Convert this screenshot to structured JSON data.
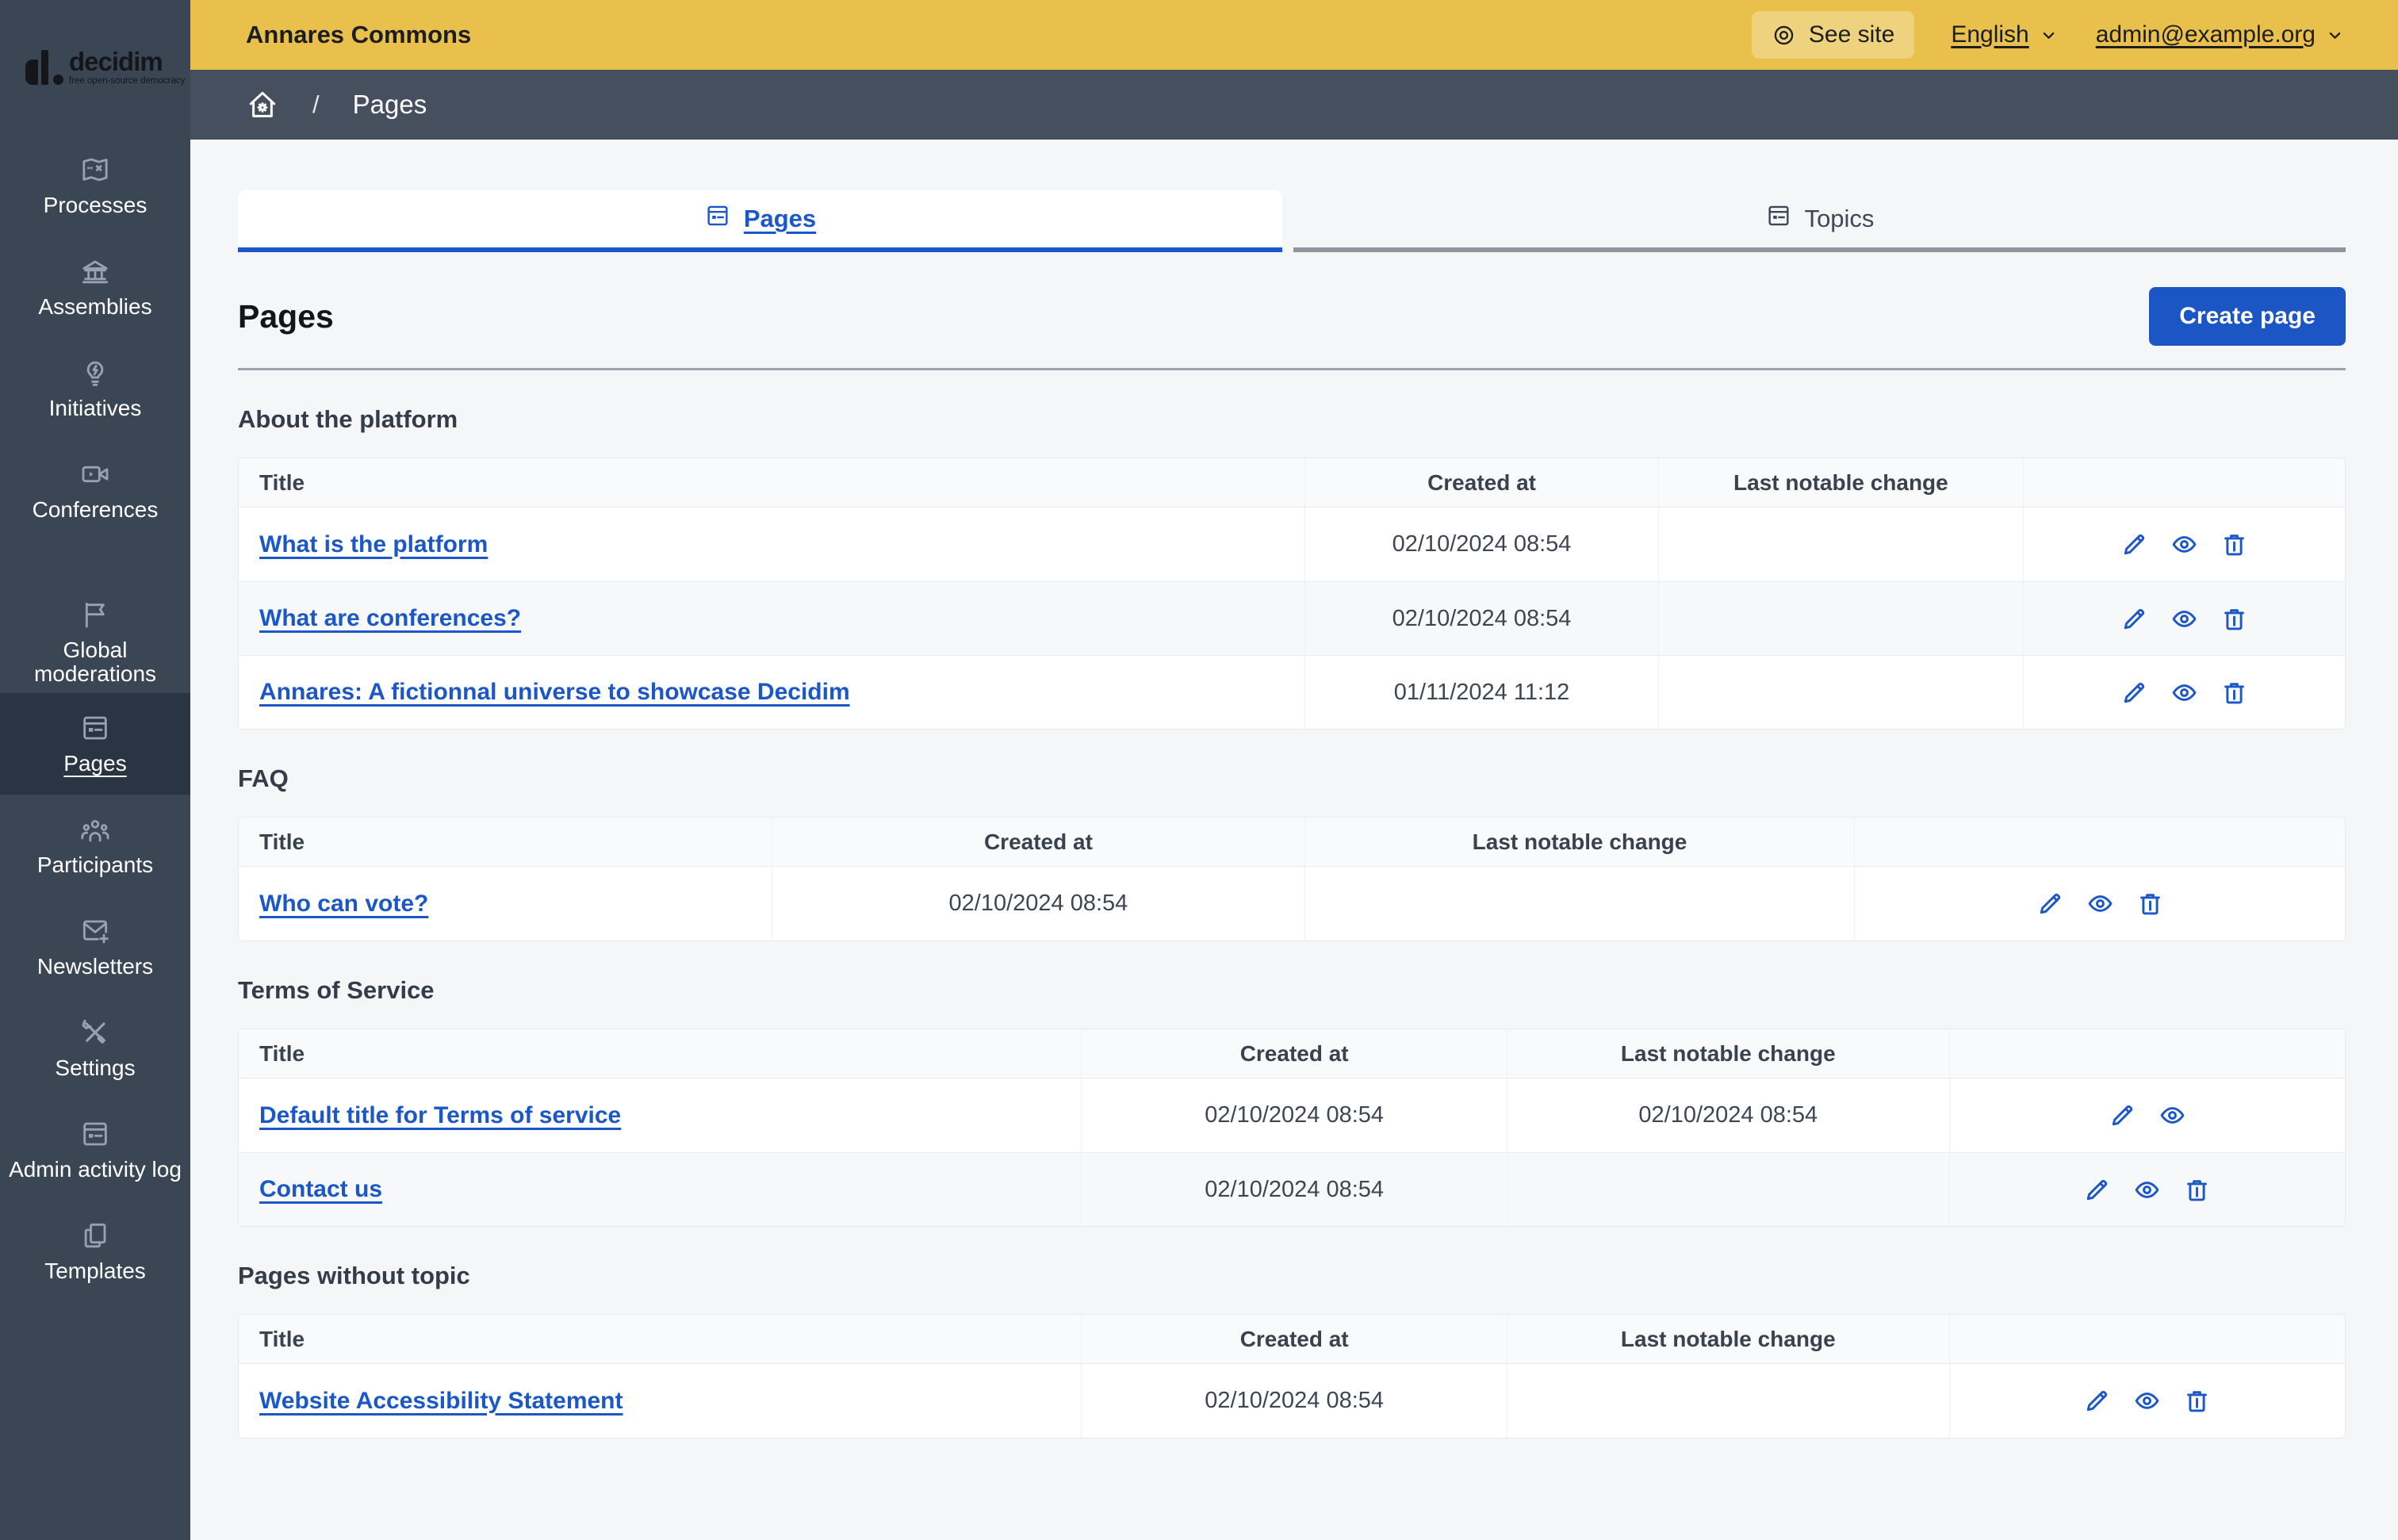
{
  "brand": {
    "logo_text": "decidim",
    "logo_tagline": "free open-source democracy"
  },
  "topbar": {
    "title": "Annares Commons",
    "see_site_label": "See site",
    "language_label": "English",
    "user_email": "admin@example.org"
  },
  "breadcrumb": {
    "separator": "/",
    "current": "Pages"
  },
  "sidebar": {
    "items": [
      {
        "label": "Processes",
        "icon": "map-icon",
        "active": false
      },
      {
        "label": "Assemblies",
        "icon": "bank-icon",
        "active": false
      },
      {
        "label": "Initiatives",
        "icon": "lightbulb-icon",
        "active": false
      },
      {
        "label": "Conferences",
        "icon": "video-camera-icon",
        "active": false
      },
      {
        "label": "Global moderations",
        "icon": "flag-icon",
        "active": false,
        "section_break": true
      },
      {
        "label": "Pages",
        "icon": "article-icon",
        "active": true
      },
      {
        "label": "Participants",
        "icon": "people-icon",
        "active": false
      },
      {
        "label": "Newsletters",
        "icon": "mail-add-icon",
        "active": false
      },
      {
        "label": "Settings",
        "icon": "tools-icon",
        "active": false
      },
      {
        "label": "Admin activity log",
        "icon": "article-icon",
        "active": false
      },
      {
        "label": "Templates",
        "icon": "copy-icon",
        "active": false
      }
    ]
  },
  "tabs": [
    {
      "label": "Pages",
      "icon": "article-icon",
      "active": true
    },
    {
      "label": "Topics",
      "icon": "article-icon",
      "active": false
    }
  ],
  "page": {
    "title": "Pages",
    "create_button_label": "Create page"
  },
  "sections": [
    {
      "title": "About the platform",
      "columns": [
        "Title",
        "Created at",
        "Last notable change"
      ],
      "col_widths": [
        "50.6%",
        "16.8%",
        "17.3%",
        "15.3%"
      ],
      "rows": [
        {
          "title": "What is the platform",
          "created_at": "02/10/2024 08:54",
          "last_change": "",
          "actions": [
            "edit",
            "preview",
            "delete"
          ]
        },
        {
          "title": "What are conferences?",
          "created_at": "02/10/2024 08:54",
          "last_change": "",
          "actions": [
            "edit",
            "preview",
            "delete"
          ]
        },
        {
          "title": "Annares: A fictionnal universe to showcase Decidim",
          "created_at": "01/11/2024 11:12",
          "last_change": "",
          "actions": [
            "edit",
            "preview",
            "delete"
          ]
        }
      ]
    },
    {
      "title": "FAQ",
      "columns": [
        "Title",
        "Created at",
        "Last notable change"
      ],
      "col_widths": [
        "25.3%",
        "25.3%",
        "26.1%",
        "23.3%"
      ],
      "rows": [
        {
          "title": "Who can vote?",
          "created_at": "02/10/2024 08:54",
          "last_change": "",
          "actions": [
            "edit",
            "preview",
            "delete"
          ]
        }
      ]
    },
    {
      "title": "Terms of Service",
      "columns": [
        "Title",
        "Created at",
        "Last notable change"
      ],
      "col_widths": [
        "40.0%",
        "20.2%",
        "21.0%",
        "18.8%"
      ],
      "rows": [
        {
          "title": "Default title for Terms of service",
          "created_at": "02/10/2024 08:54",
          "last_change": "02/10/2024 08:54",
          "actions": [
            "edit",
            "preview"
          ]
        },
        {
          "title": "Contact us",
          "created_at": "02/10/2024 08:54",
          "last_change": "",
          "actions": [
            "edit",
            "preview",
            "delete"
          ]
        }
      ]
    },
    {
      "title": "Pages without topic",
      "columns": [
        "Title",
        "Created at",
        "Last notable change"
      ],
      "col_widths": [
        "40.0%",
        "20.2%",
        "21.0%",
        "18.8%"
      ],
      "rows": [
        {
          "title": "Website Accessibility Statement",
          "created_at": "02/10/2024 08:54",
          "last_change": "",
          "actions": [
            "edit",
            "preview",
            "delete"
          ]
        }
      ]
    }
  ],
  "colors": {
    "topbar_yellow": "#e9c04b",
    "sidebar": "#3b4655",
    "sidebar_active": "#2a3543",
    "breadcrumb_bar": "#454f5e",
    "content_bg": "#f5f6f8",
    "primary_blue": "#1b56c4",
    "link_blue": "#1b57c7",
    "header_row_bg": "#f8fafc",
    "alt_row_bg": "#f7f8fa",
    "table_border": "#e6eaef"
  }
}
